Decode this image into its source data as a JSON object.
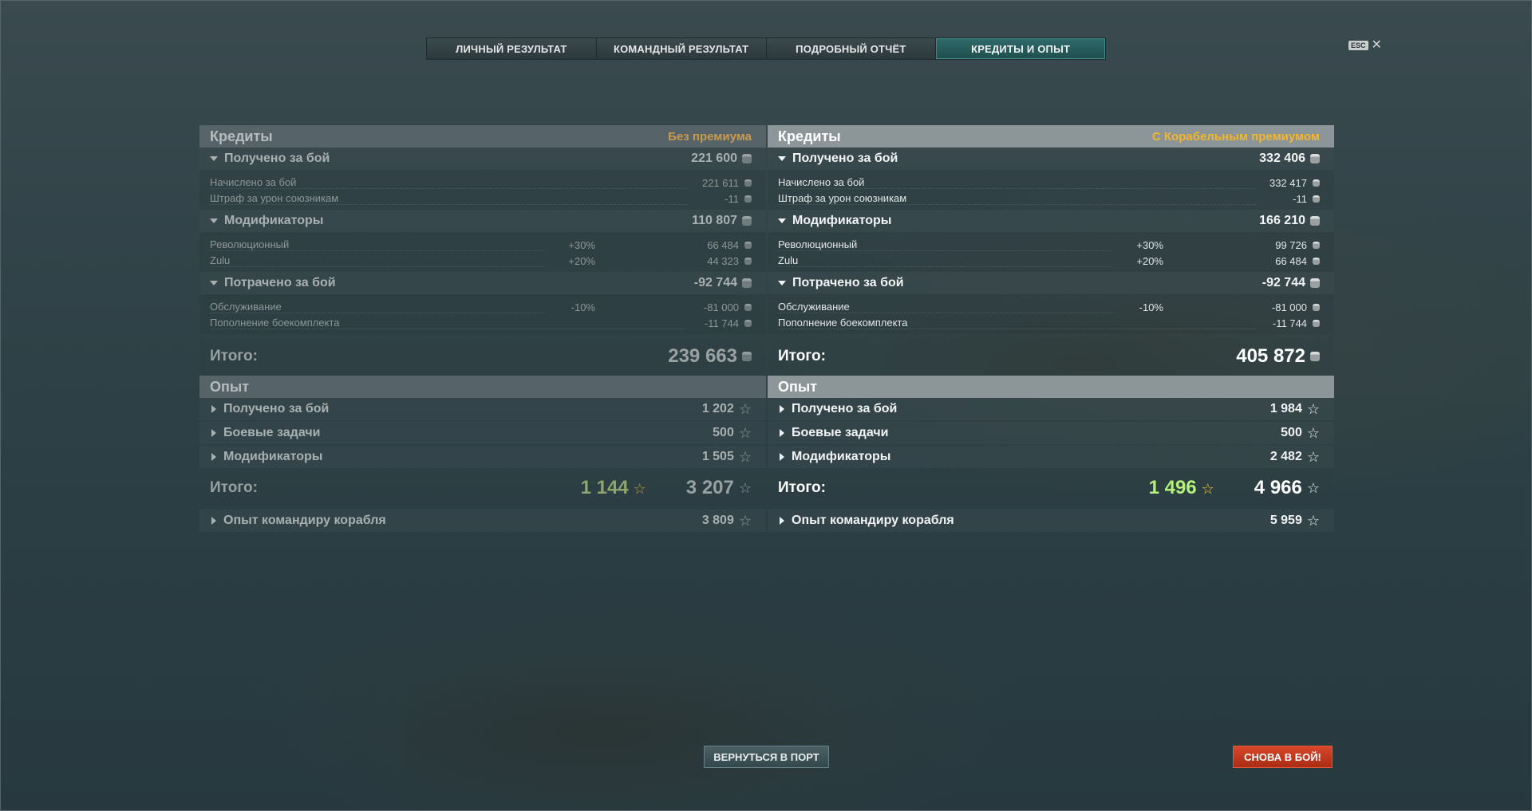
{
  "tabs": [
    {
      "label": "ЛИЧНЫЙ РЕЗУЛЬТАТ",
      "active": false
    },
    {
      "label": "КОМАНДНЫЙ РЕЗУЛЬТАТ",
      "active": false
    },
    {
      "label": "ПОДРОБНЫЙ ОТЧЁТ",
      "active": false
    },
    {
      "label": "КРЕДИТЫ И ОПЫТ",
      "active": true
    }
  ],
  "close": {
    "key_label": "ESC",
    "icon": "close-icon"
  },
  "left": {
    "credits_title": "Кредиты",
    "premium_label": "Без премиума",
    "earned": {
      "label": "Получено за бой",
      "value": "221 600",
      "items": [
        {
          "label": "Начислено за бой",
          "value": "221 611"
        },
        {
          "label": "Штраф за урон союзникам",
          "value": "-11"
        }
      ]
    },
    "modifiers": {
      "label": "Модификаторы",
      "value": "110 807",
      "items": [
        {
          "label": "Революционный",
          "pct": "+30%",
          "value": "66 484"
        },
        {
          "label": "Zulu",
          "pct": "+20%",
          "value": "44 323"
        }
      ]
    },
    "spent": {
      "label": "Потрачено за бой",
      "value": "-92 744",
      "items": [
        {
          "label": "Обслуживание",
          "pct": "-10%",
          "value": "-81 000"
        },
        {
          "label": "Пополнение боекомплекта",
          "value": "-11 744"
        }
      ]
    },
    "credits_total_label": "Итого:",
    "credits_total": "239 663",
    "xp_title": "Опыт",
    "xp_rows": [
      {
        "label": "Получено за бой",
        "value": "1 202"
      },
      {
        "label": "Боевые задачи",
        "value": "500"
      },
      {
        "label": "Модификаторы",
        "value": "1 505"
      }
    ],
    "xp_total_label": "Итого:",
    "xp_base": "1 144",
    "xp_total": "3 207",
    "commander": {
      "label": "Опыт командиру корабля",
      "value": "3 809"
    }
  },
  "right": {
    "credits_title": "Кредиты",
    "premium_label": "С Корабельным премиумом",
    "earned": {
      "label": "Получено за бой",
      "value": "332 406",
      "items": [
        {
          "label": "Начислено за бой",
          "value": "332 417"
        },
        {
          "label": "Штраф за урон союзникам",
          "value": "-11"
        }
      ]
    },
    "modifiers": {
      "label": "Модификаторы",
      "value": "166 210",
      "items": [
        {
          "label": "Революционный",
          "pct": "+30%",
          "value": "99 726"
        },
        {
          "label": "Zulu",
          "pct": "+20%",
          "value": "66 484"
        }
      ]
    },
    "spent": {
      "label": "Потрачено за бой",
      "value": "-92 744",
      "items": [
        {
          "label": "Обслуживание",
          "pct": "-10%",
          "value": "-81 000"
        },
        {
          "label": "Пополнение боекомплекта",
          "value": "-11 744"
        }
      ]
    },
    "credits_total_label": "Итого:",
    "credits_total": "405 872",
    "xp_title": "Опыт",
    "xp_rows": [
      {
        "label": "Получено за бой",
        "value": "1 984"
      },
      {
        "label": "Боевые задачи",
        "value": "500"
      },
      {
        "label": "Модификаторы",
        "value": "2 482"
      }
    ],
    "xp_total_label": "Итого:",
    "xp_base": "1 496",
    "xp_total": "4 966",
    "commander": {
      "label": "Опыт командиру корабля",
      "value": "5 959"
    }
  },
  "buttons": {
    "return_port": "ВЕРНУТЬСЯ В ПОРТ",
    "battle_again": "СНОВА В БОЙ!"
  },
  "colors": {
    "accent_tab": "#2f6c6a",
    "premium_gold": "#f1b62e",
    "xp_green": "#b4f07a",
    "battle_red": "#d8472a"
  }
}
